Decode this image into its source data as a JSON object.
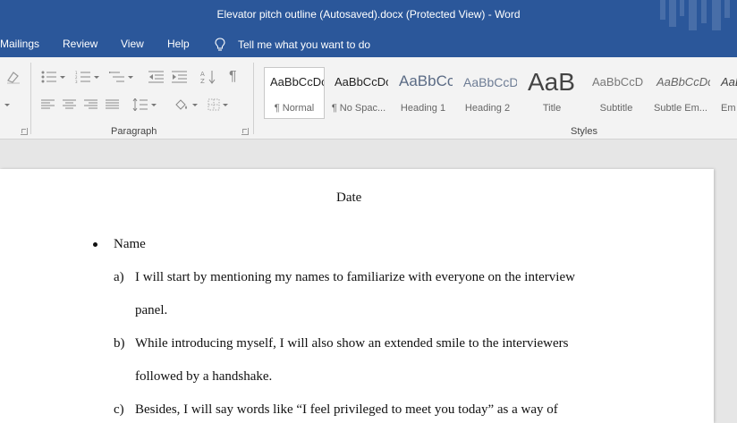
{
  "window": {
    "title": "Elevator pitch outline (Autosaved).docx (Protected View)  -  Word"
  },
  "menu": {
    "items": [
      "Mailings",
      "Review",
      "View",
      "Help"
    ],
    "tell_me": "Tell me what you want to do"
  },
  "ribbon": {
    "paragraph_label": "Paragraph",
    "styles_label": "Styles",
    "styles": [
      {
        "preview": "AaBbCcDc",
        "name": "¶ Normal"
      },
      {
        "preview": "AaBbCcDc",
        "name": "¶ No Spac..."
      },
      {
        "preview": "AaBbCc",
        "name": "Heading 1"
      },
      {
        "preview": "AaBbCcD",
        "name": "Heading 2"
      },
      {
        "preview": "AaB",
        "name": "Title"
      },
      {
        "preview": "AaBbCcD",
        "name": "Subtitle"
      },
      {
        "preview": "AaBbCcDc",
        "name": "Subtle Em..."
      },
      {
        "preview": "AaBbCcDc",
        "name": "Em"
      }
    ]
  },
  "document": {
    "date": "Date",
    "bullet": "Name",
    "items": [
      {
        "marker": "a)",
        "lines": [
          "I will start by mentioning my names to familiarize with everyone on the interview",
          "panel."
        ]
      },
      {
        "marker": "b)",
        "lines": [
          "While introducing myself, I will also show an extended smile to the interviewers",
          "followed by a handshake."
        ]
      },
      {
        "marker": "c)",
        "lines": [
          "Besides, I will say words like “I feel privileged to meet you today” as a way of"
        ]
      }
    ]
  }
}
